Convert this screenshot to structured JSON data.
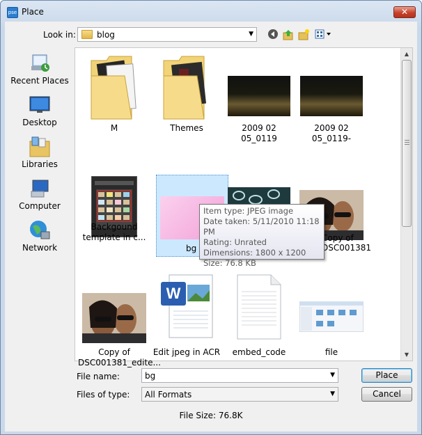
{
  "window": {
    "title": "Place",
    "app_icon_text": "pse"
  },
  "toolbar": {
    "look_in_label": "Look in:",
    "look_in_value": "blog",
    "back_icon": "back-icon",
    "up_icon": "up-folder-icon",
    "new_folder_icon": "new-folder-icon",
    "view_icon": "view-menu-icon"
  },
  "places": [
    {
      "label": "Recent Places",
      "icon": "recent-places-icon"
    },
    {
      "label": "Desktop",
      "icon": "desktop-icon"
    },
    {
      "label": "Libraries",
      "icon": "libraries-icon"
    },
    {
      "label": "Computer",
      "icon": "computer-icon"
    },
    {
      "label": "Network",
      "icon": "network-icon"
    }
  ],
  "files": [
    {
      "label": "M",
      "kind": "folder"
    },
    {
      "label": "Themes",
      "kind": "folder"
    },
    {
      "label": "2009 02 05_0119",
      "kind": "photo"
    },
    {
      "label": "2009 02 05_0119-",
      "kind": "photo"
    },
    {
      "label": "Backgound template in c...",
      "kind": "image"
    },
    {
      "label": "bg",
      "kind": "image",
      "selected": true
    },
    {
      "label": "",
      "kind": "image"
    },
    {
      "label": "Copy of DSC001381",
      "kind": "photo"
    },
    {
      "label": "Copy of DSC001381_edite...",
      "kind": "photo"
    },
    {
      "label": "Edit jpeg in ACR",
      "kind": "document"
    },
    {
      "label": "embed_code",
      "kind": "document"
    },
    {
      "label": "file",
      "kind": "image"
    }
  ],
  "tooltip": {
    "item_type": "Item type: JPEG image",
    "date_taken": "Date taken: 5/11/2010 11:18 PM",
    "rating": "Rating: Unrated",
    "dimensions": "Dimensions: 1800 x 1200",
    "size": "Size: 76.8 KB"
  },
  "form": {
    "file_name_label": "File name:",
    "file_name_value": "bg",
    "files_of_type_label": "Files of type:",
    "files_of_type_value": "All Formats",
    "place_button": "Place",
    "cancel_button": "Cancel",
    "file_size": "File Size: 76.8K"
  },
  "colors": {
    "selection": "#cce8ff",
    "accent": "#3c7fb1"
  }
}
